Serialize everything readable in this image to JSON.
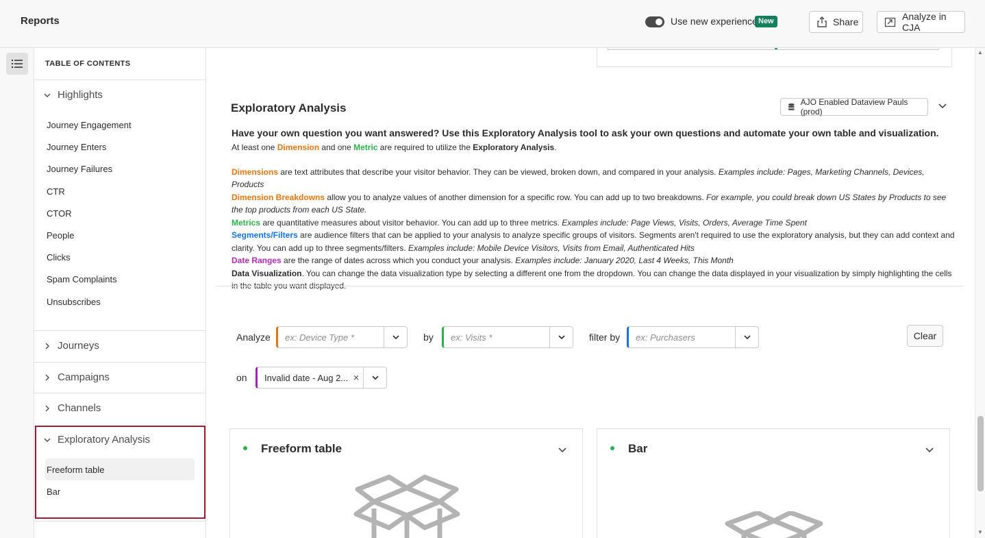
{
  "header": {
    "title": "Reports",
    "toggle_label": "Use new experience",
    "new_badge": "New",
    "share_label": "Share",
    "cja_label": "Analyze in CJA"
  },
  "toc": {
    "heading": "TABLE OF CONTENTS",
    "highlights": {
      "title": "Highlights",
      "items": [
        "Journey Engagement",
        "Journey Enters",
        "Journey Failures",
        "CTR",
        "CTOR",
        "People",
        "Clicks",
        "Spam Complaints",
        "Unsubscribes"
      ]
    },
    "journeys": "Journeys",
    "campaigns": "Campaigns",
    "channels": "Channels",
    "exploratory": {
      "title": "Exploratory Analysis",
      "items": [
        "Freeform table",
        "Bar"
      ]
    }
  },
  "main": {
    "title": "Exploratory Analysis",
    "dataview": "AJO Enabled Dataview Pauls (prod)",
    "intro": {
      "lead": "Have your own question you want answered? Use this Exploratory Analysis tool to ask your own questions and automate your own table and visualization.",
      "req_1": "At least one ",
      "req_dimension": "Dimension",
      "req_2": " and one ",
      "req_metric": "Metric",
      "req_3": " are required to utilize the ",
      "req_ea": "Exploratory Analysis",
      "req_4": ".",
      "dimensions_term": "Dimensions",
      "dimensions_text": " are text attributes that describe your visitor behavior. They can be viewed, broken down, and compared in your analysis. ",
      "dimensions_ex": "Examples include: Pages, Marketing Channels, Devices, Products",
      "breakdowns_term": "Dimension Breakdowns",
      "breakdowns_text": " allow you to analyze values of another dimension for a specific row. You can add up to two breakdowns. ",
      "breakdowns_ex": "For example, you could break down US States by Products to see the top products from each US State.",
      "metrics_term": "Metrics",
      "metrics_text": " are quantitative measures about visitor behavior. You can add up to three metrics. ",
      "metrics_ex": "Examples include: Page Views, Visits, Orders, Average Time Spent",
      "segments_term": "Segments/Filters",
      "segments_text": " are audience filters that can be applied to your analysis to analyze specific groups of visitors. Segments aren't required to use the exploratory analysis, but they can add context and clarity. You can add up to three segments/filters. ",
      "segments_ex": "Examples include: Mobile Device Visitors, Visits from Email, Authenticated Hits",
      "dates_term": "Date Ranges",
      "dates_text": " are the range of dates across which you conduct your analysis. ",
      "dates_ex": "Examples include: January 2020, Last 4 Weeks, This Month",
      "dataviz_term": "Data Visualization",
      "dataviz_text": ". You can change the data visualization type by selecting a different one from the dropdown. You can change the data displayed in your visualization by simply highlighting the cells in the table you want displayed."
    },
    "builder": {
      "analyze_label": "Analyze",
      "dimension_placeholder": "ex: Device Type *",
      "by_label": "by",
      "metric_placeholder": "ex: Visits *",
      "filter_label": "filter by",
      "filter_placeholder": "ex: Purchasers",
      "clear_label": "Clear",
      "on_label": "on",
      "date_value": "Invalid date - Aug 2..."
    },
    "viz_cards": [
      {
        "title": "Freeform table"
      },
      {
        "title": "Bar"
      }
    ]
  },
  "colors": {
    "dimension": "#e8750f",
    "metric": "#2bb349",
    "segment": "#1473e6",
    "date": "#b62bb5",
    "selection_frame": "#a51c30"
  },
  "icons": [
    "share-icon",
    "open-external-icon",
    "toc-list-icon",
    "chevron-down-icon",
    "chevron-right-icon",
    "database-icon",
    "clear-x-icon",
    "empty-box-icon"
  ]
}
